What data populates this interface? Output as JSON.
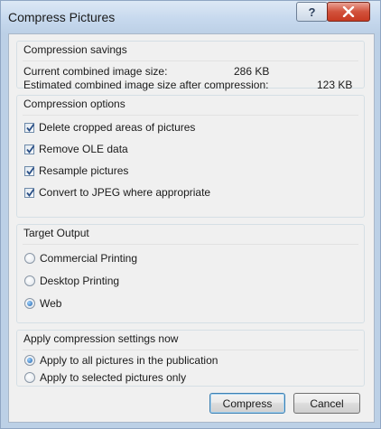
{
  "dialog": {
    "title": "Compress Pictures",
    "help_label": "?"
  },
  "savings": {
    "heading": "Compression savings",
    "current_label": "Current combined image size:",
    "current_value": "286 KB",
    "estimated_label": "Estimated combined image size after compression:",
    "estimated_value": "123 KB"
  },
  "options": {
    "heading": "Compression options",
    "items": [
      {
        "label": "Delete cropped areas of pictures",
        "checked": true
      },
      {
        "label": "Remove OLE data",
        "checked": true
      },
      {
        "label": "Resample pictures",
        "checked": true
      },
      {
        "label": "Convert to JPEG where appropriate",
        "checked": true
      }
    ]
  },
  "target": {
    "heading": "Target Output",
    "items": [
      {
        "label": "Commercial Printing",
        "selected": false
      },
      {
        "label": "Desktop Printing",
        "selected": false
      },
      {
        "label": "Web",
        "selected": true
      }
    ]
  },
  "apply": {
    "heading": "Apply compression settings now",
    "items": [
      {
        "label": "Apply to all pictures in the publication",
        "selected": true
      },
      {
        "label": "Apply to selected pictures only",
        "selected": false
      }
    ]
  },
  "buttons": {
    "compress_label": "Compress",
    "cancel_label": "Cancel"
  }
}
